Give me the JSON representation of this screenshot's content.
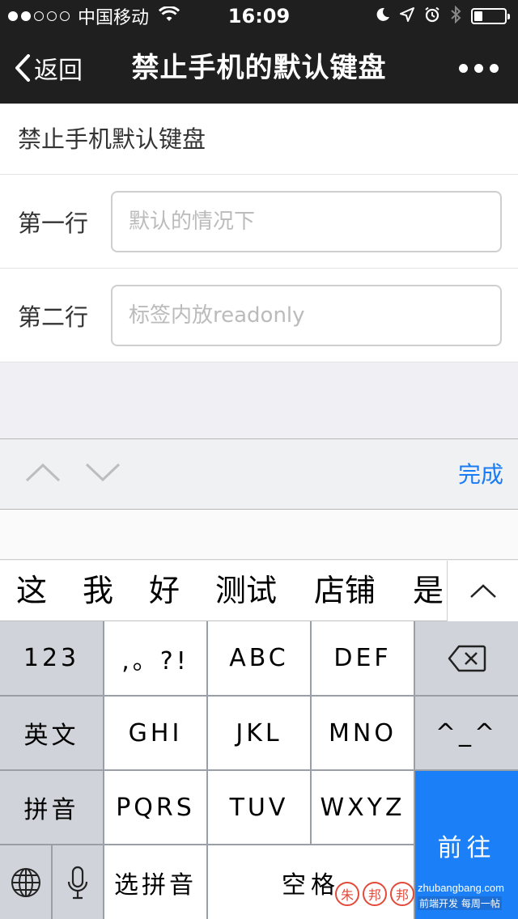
{
  "status_bar": {
    "carrier": "中国移动",
    "time": "16:09"
  },
  "nav": {
    "back_label": "返回",
    "title": "禁止手机的默认键盘"
  },
  "content": {
    "heading": "禁止手机默认键盘",
    "rows": [
      {
        "label": "第一行",
        "placeholder": "默认的情况下"
      },
      {
        "label": "第二行",
        "placeholder": "标签内放readonly"
      }
    ]
  },
  "accessory": {
    "done_label": "完成"
  },
  "candidates": [
    "这",
    "我",
    "好",
    "测试",
    "店铺",
    "是"
  ],
  "keyboard": {
    "num_key": "123",
    "punct_key": ",。?!",
    "abc": "ABC",
    "def": "DEF",
    "english_key": "英文",
    "ghi": "GHI",
    "jkl": "JKL",
    "mno": "MNO",
    "emoticon_key": "^_^",
    "pinyin_key": "拼音",
    "pqrs": "PQRS",
    "tuv": "TUV",
    "wxyz": "WXYZ",
    "go_key": "前往",
    "select_pinyin_key": "选拼音",
    "space_key": "空格"
  },
  "watermark": {
    "text": "朱邦邦",
    "site": "zhubangbang.com",
    "slogan": "前端开发 每周一帖"
  }
}
